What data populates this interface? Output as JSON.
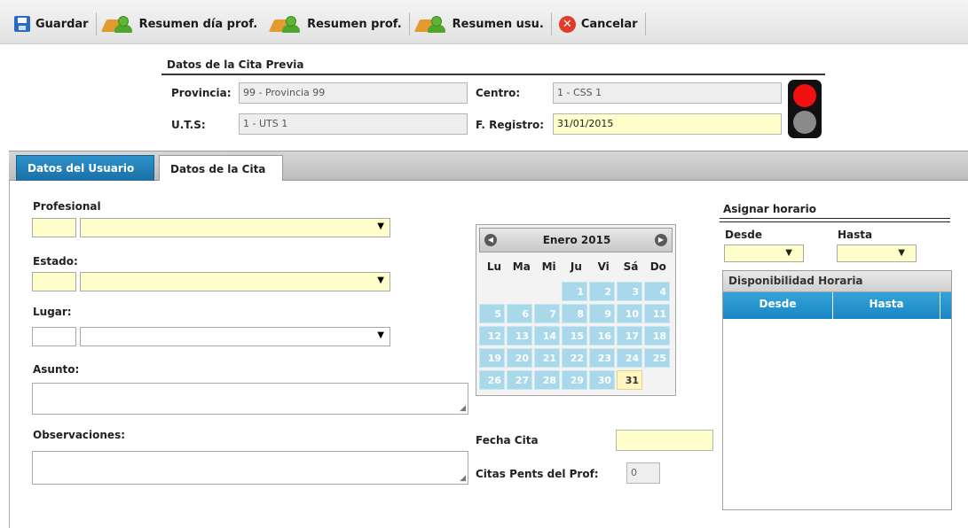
{
  "toolbar": {
    "guardar": "Guardar",
    "resumen_dia_prof": "Resumen día prof.",
    "resumen_prof": "Resumen prof.",
    "resumen_usu": "Resumen usu.",
    "cancelar": "Cancelar"
  },
  "header": {
    "title": "Datos de la Cita Previa",
    "provincia_label": "Provincia:",
    "provincia_value": "99 - Provincia 99",
    "centro_label": "Centro:",
    "centro_value": "1 - CSS 1",
    "uts_label": "U.T.S:",
    "uts_value": "1 - UTS 1",
    "registro_label": "F. Registro:",
    "registro_value": "31/01/2015"
  },
  "tabs": [
    {
      "label": "Datos del Usuario"
    },
    {
      "label": "Datos de la Cita"
    }
  ],
  "form": {
    "profesional": "Profesional",
    "estado": "Estado:",
    "lugar": "Lugar:",
    "asunto": "Asunto:",
    "observaciones": "Observaciones:"
  },
  "calendar": {
    "title": "Enero 2015",
    "dow": [
      "Lu",
      "Ma",
      "Mi",
      "Ju",
      "Vi",
      "Sá",
      "Do"
    ],
    "days": [
      "1",
      "2",
      "3",
      "4",
      "5",
      "6",
      "7",
      "8",
      "9",
      "10",
      "11",
      "12",
      "13",
      "14",
      "15",
      "16",
      "17",
      "18",
      "19",
      "20",
      "21",
      "22",
      "23",
      "24",
      "25",
      "26",
      "27",
      "28",
      "29",
      "30",
      "31"
    ],
    "today": "31"
  },
  "fecha_cita_label": "Fecha Cita",
  "citas_pents_label": "Citas Pents del Prof:",
  "citas_pents_value": "0",
  "asignar": {
    "title": "Asignar horario",
    "desde": "Desde",
    "hasta": "Hasta"
  },
  "disponibilidad": {
    "title": "Disponibilidad Horaria",
    "col_desde": "Desde",
    "col_hasta": "Hasta"
  }
}
